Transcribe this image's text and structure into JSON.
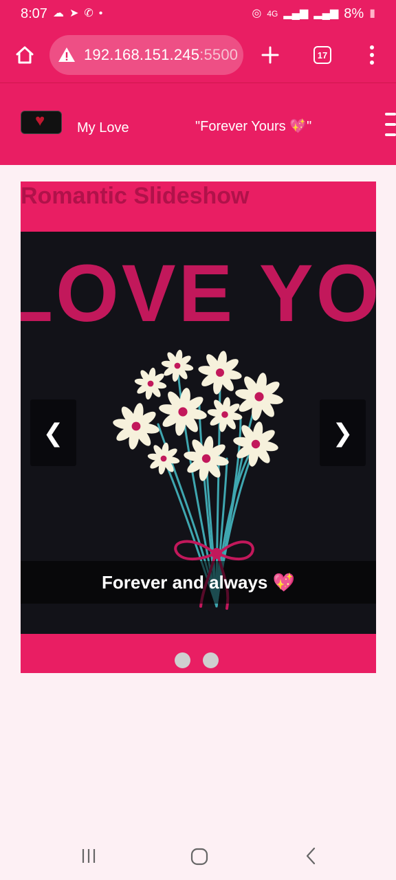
{
  "status_bar": {
    "time": "8:07",
    "battery": "8%",
    "network": "4G"
  },
  "browser": {
    "url_prefix": "192.168.151.245",
    "url_port": ":5500",
    "tab_count": "17"
  },
  "site": {
    "title": "My Love",
    "quote": "\"Forever Yours 💖\""
  },
  "slideshow": {
    "heading": "Romantic Slideshow",
    "slide_headline": "I LOVE YOU",
    "caption": "Forever and always 💖",
    "prev_label": "❮",
    "next_label": "❯",
    "dot_count": 2
  },
  "colors": {
    "accent": "#e91e63",
    "heading_text": "#b0124a",
    "slide_bg": "#121218",
    "flower_petal": "#f6f1dc",
    "flower_center": "#c2185b",
    "stem": "#3fa7b0"
  }
}
